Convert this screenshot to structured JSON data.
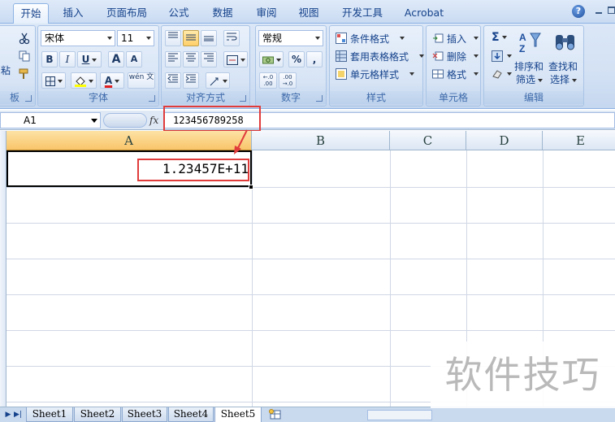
{
  "tabs": [
    {
      "label": "开始",
      "active": true
    },
    {
      "label": "插入"
    },
    {
      "label": "页面布局"
    },
    {
      "label": "公式"
    },
    {
      "label": "数据"
    },
    {
      "label": "审阅"
    },
    {
      "label": "视图"
    },
    {
      "label": "开发工具"
    },
    {
      "label": "Acrobat"
    }
  ],
  "window_icons": {
    "help": "?",
    "minimize": "minimize-icon",
    "restore": "restore-icon"
  },
  "ribbon": {
    "clipboard": {
      "label": "板",
      "paste_label": "粘"
    },
    "font": {
      "label": "字体",
      "font_name": "宋体",
      "font_size": "11",
      "bold": "B",
      "italic": "I",
      "underline": "U",
      "grow": "A",
      "shrink": "A",
      "font_color": "A",
      "phonetic": "wén 文"
    },
    "alignment": {
      "label": "对齐方式"
    },
    "number": {
      "label": "数字",
      "format": "常规",
      "percent": "%",
      "comma": ",",
      "inc_decimal": "←.0 .00",
      "dec_decimal": ".00 →.0"
    },
    "styles": {
      "label": "样式",
      "conditional": "条件格式",
      "table": "套用表格格式",
      "cell_styles": "单元格样式"
    },
    "cells": {
      "label": "单元格",
      "insert": "插入",
      "delete": "删除",
      "format": "格式"
    },
    "editing": {
      "label": "编辑",
      "sum": "Σ",
      "sort_line1": "排序和",
      "sort_line2": "筛选",
      "find_line1": "查找和",
      "find_line2": "选择"
    }
  },
  "formula_bar": {
    "name_box": "A1",
    "fx": "fx",
    "value": "123456789258"
  },
  "columns": [
    "A",
    "B",
    "C",
    "D",
    "E"
  ],
  "selected_column": "A",
  "cell_a1_display": "1.23457E+11",
  "sheets": [
    {
      "label": "Sheet1"
    },
    {
      "label": "Sheet2"
    },
    {
      "label": "Sheet3"
    },
    {
      "label": "Sheet4"
    },
    {
      "label": "Sheet5",
      "active": true
    }
  ],
  "watermark": "软件技巧",
  "colors": {
    "annotation": "#e03c3c",
    "selected_header": "#f9c56a",
    "ribbon": "#d3e1f4"
  }
}
